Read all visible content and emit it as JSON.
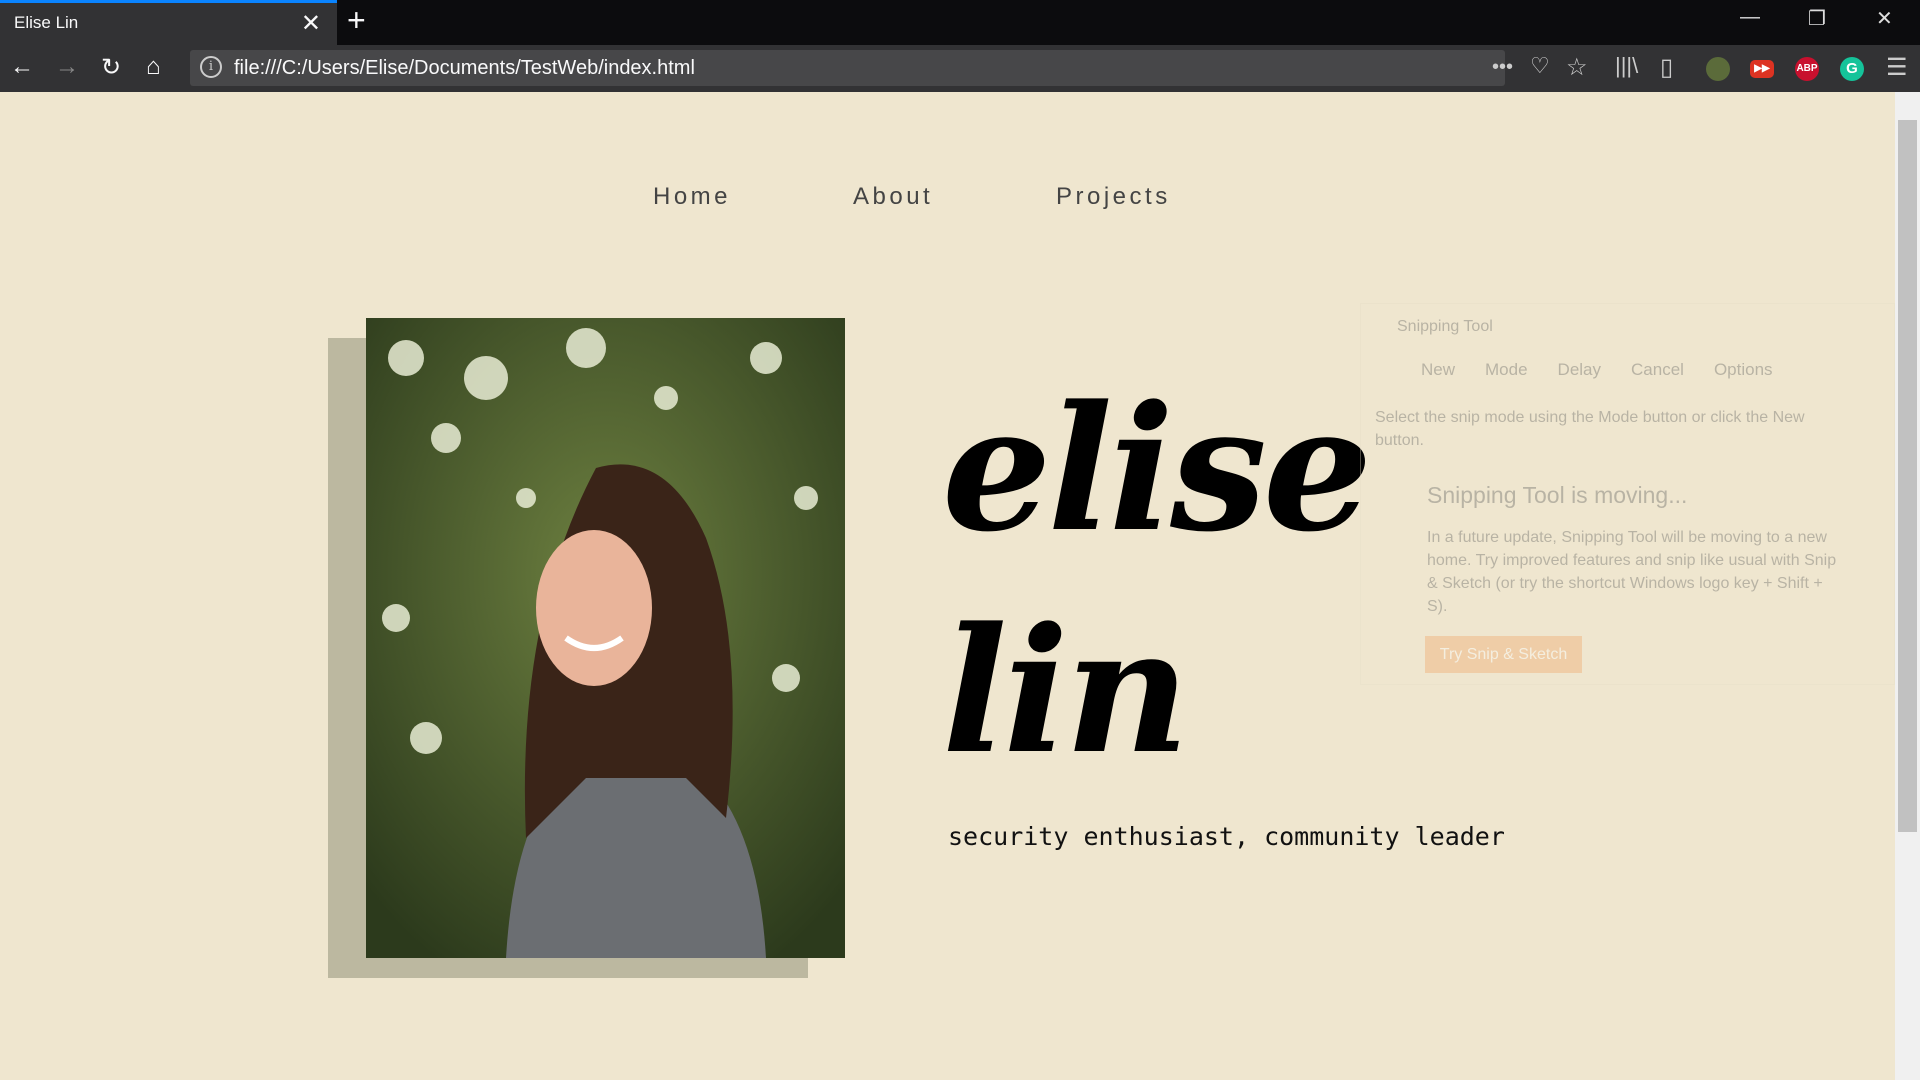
{
  "browser": {
    "tab_title": "Elise Lin",
    "url": "file:///C:/Users/Elise/Documents/TestWeb/index.html",
    "extensions": [
      "ABP"
    ],
    "accent": "#0a84ff"
  },
  "page": {
    "nav": [
      "Home",
      "About",
      "Projects"
    ],
    "first_name": "elise",
    "last_name": "lin",
    "tagline": "security enthusiast, community leader",
    "background": "#efe6cf"
  },
  "snipping_tool": {
    "title": "Snipping Tool",
    "toolbar": [
      "New",
      "Mode",
      "Delay",
      "Cancel",
      "Options"
    ],
    "instructions": "Select the snip mode using the Mode button or click the New button.",
    "notice_title": "Snipping Tool is moving...",
    "notice_body": "In a future update, Snipping Tool will be moving to a new home. Try improved features and snip like usual with Snip & Sketch (or try the shortcut Windows logo key + Shift + S).",
    "button": "Try Snip & Sketch"
  }
}
